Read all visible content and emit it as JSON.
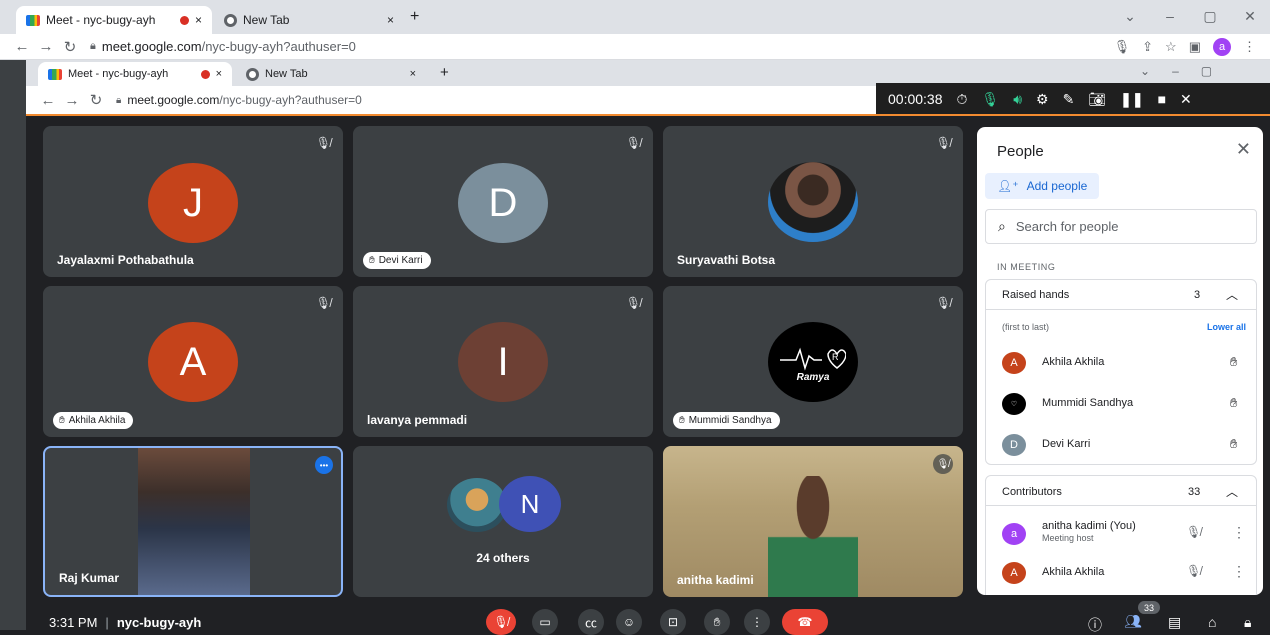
{
  "browser": {
    "tabs": [
      {
        "title": "Meet - nyc-bugy-ayh",
        "close": "×"
      },
      {
        "title": "New Tab",
        "close": "×"
      }
    ],
    "new_tab": "+",
    "url": "meet.google.com/nyc-bugy-ayh?authuser=0",
    "url_host": "meet.google.com",
    "url_path": "/nyc-bugy-ayh?authuser=0",
    "profile_initial": "a"
  },
  "recorder": {
    "time": "00:00:38"
  },
  "tiles": [
    {
      "name": "Jayalaxmi Pothabathula",
      "initial": "J",
      "color": "#c5431b"
    },
    {
      "name": "Devi Karri",
      "initial": "D",
      "color": "#7b8f9c"
    },
    {
      "name": "Suryavathi Botsa"
    },
    {
      "name": "Akhila Akhila",
      "initial": "A",
      "color": "#c5431b"
    },
    {
      "name": "lavanya pemmadi",
      "initial": "I",
      "color": "#6d4034"
    },
    {
      "name": "Mummidi Sandhya",
      "logo_text": "Ramya"
    },
    {
      "name": "Raj Kumar"
    },
    {
      "others_label": "24 others",
      "initial": "N",
      "color": "#3f51b5"
    },
    {
      "name": "anitha kadimi"
    }
  ],
  "panel": {
    "title": "People",
    "add_people": "Add people",
    "search_placeholder": "Search for people",
    "section": "IN MEETING",
    "raised_hands": {
      "label": "Raised hands",
      "count": "3",
      "hint": "(first to last)",
      "lower_all": "Lower all",
      "people": [
        {
          "name": "Akhila Akhila",
          "initial": "A",
          "color": "#c5431b"
        },
        {
          "name": "Mummidi Sandhya",
          "initial": "",
          "color": "#000000"
        },
        {
          "name": "Devi Karri",
          "initial": "D",
          "color": "#7b8f9c"
        }
      ]
    },
    "contributors": {
      "label": "Contributors",
      "count": "33",
      "people": [
        {
          "name": "anitha kadimi (You)",
          "sub": "Meeting host",
          "initial": "a",
          "color": "#a142f4"
        },
        {
          "name": "Akhila Akhila",
          "sub": "",
          "initial": "A",
          "color": "#c5431b"
        }
      ]
    }
  },
  "bottom": {
    "time": "3:31 PM",
    "separator": "|",
    "meeting_code": "nyc-bugy-ayh",
    "people_count": "33"
  }
}
